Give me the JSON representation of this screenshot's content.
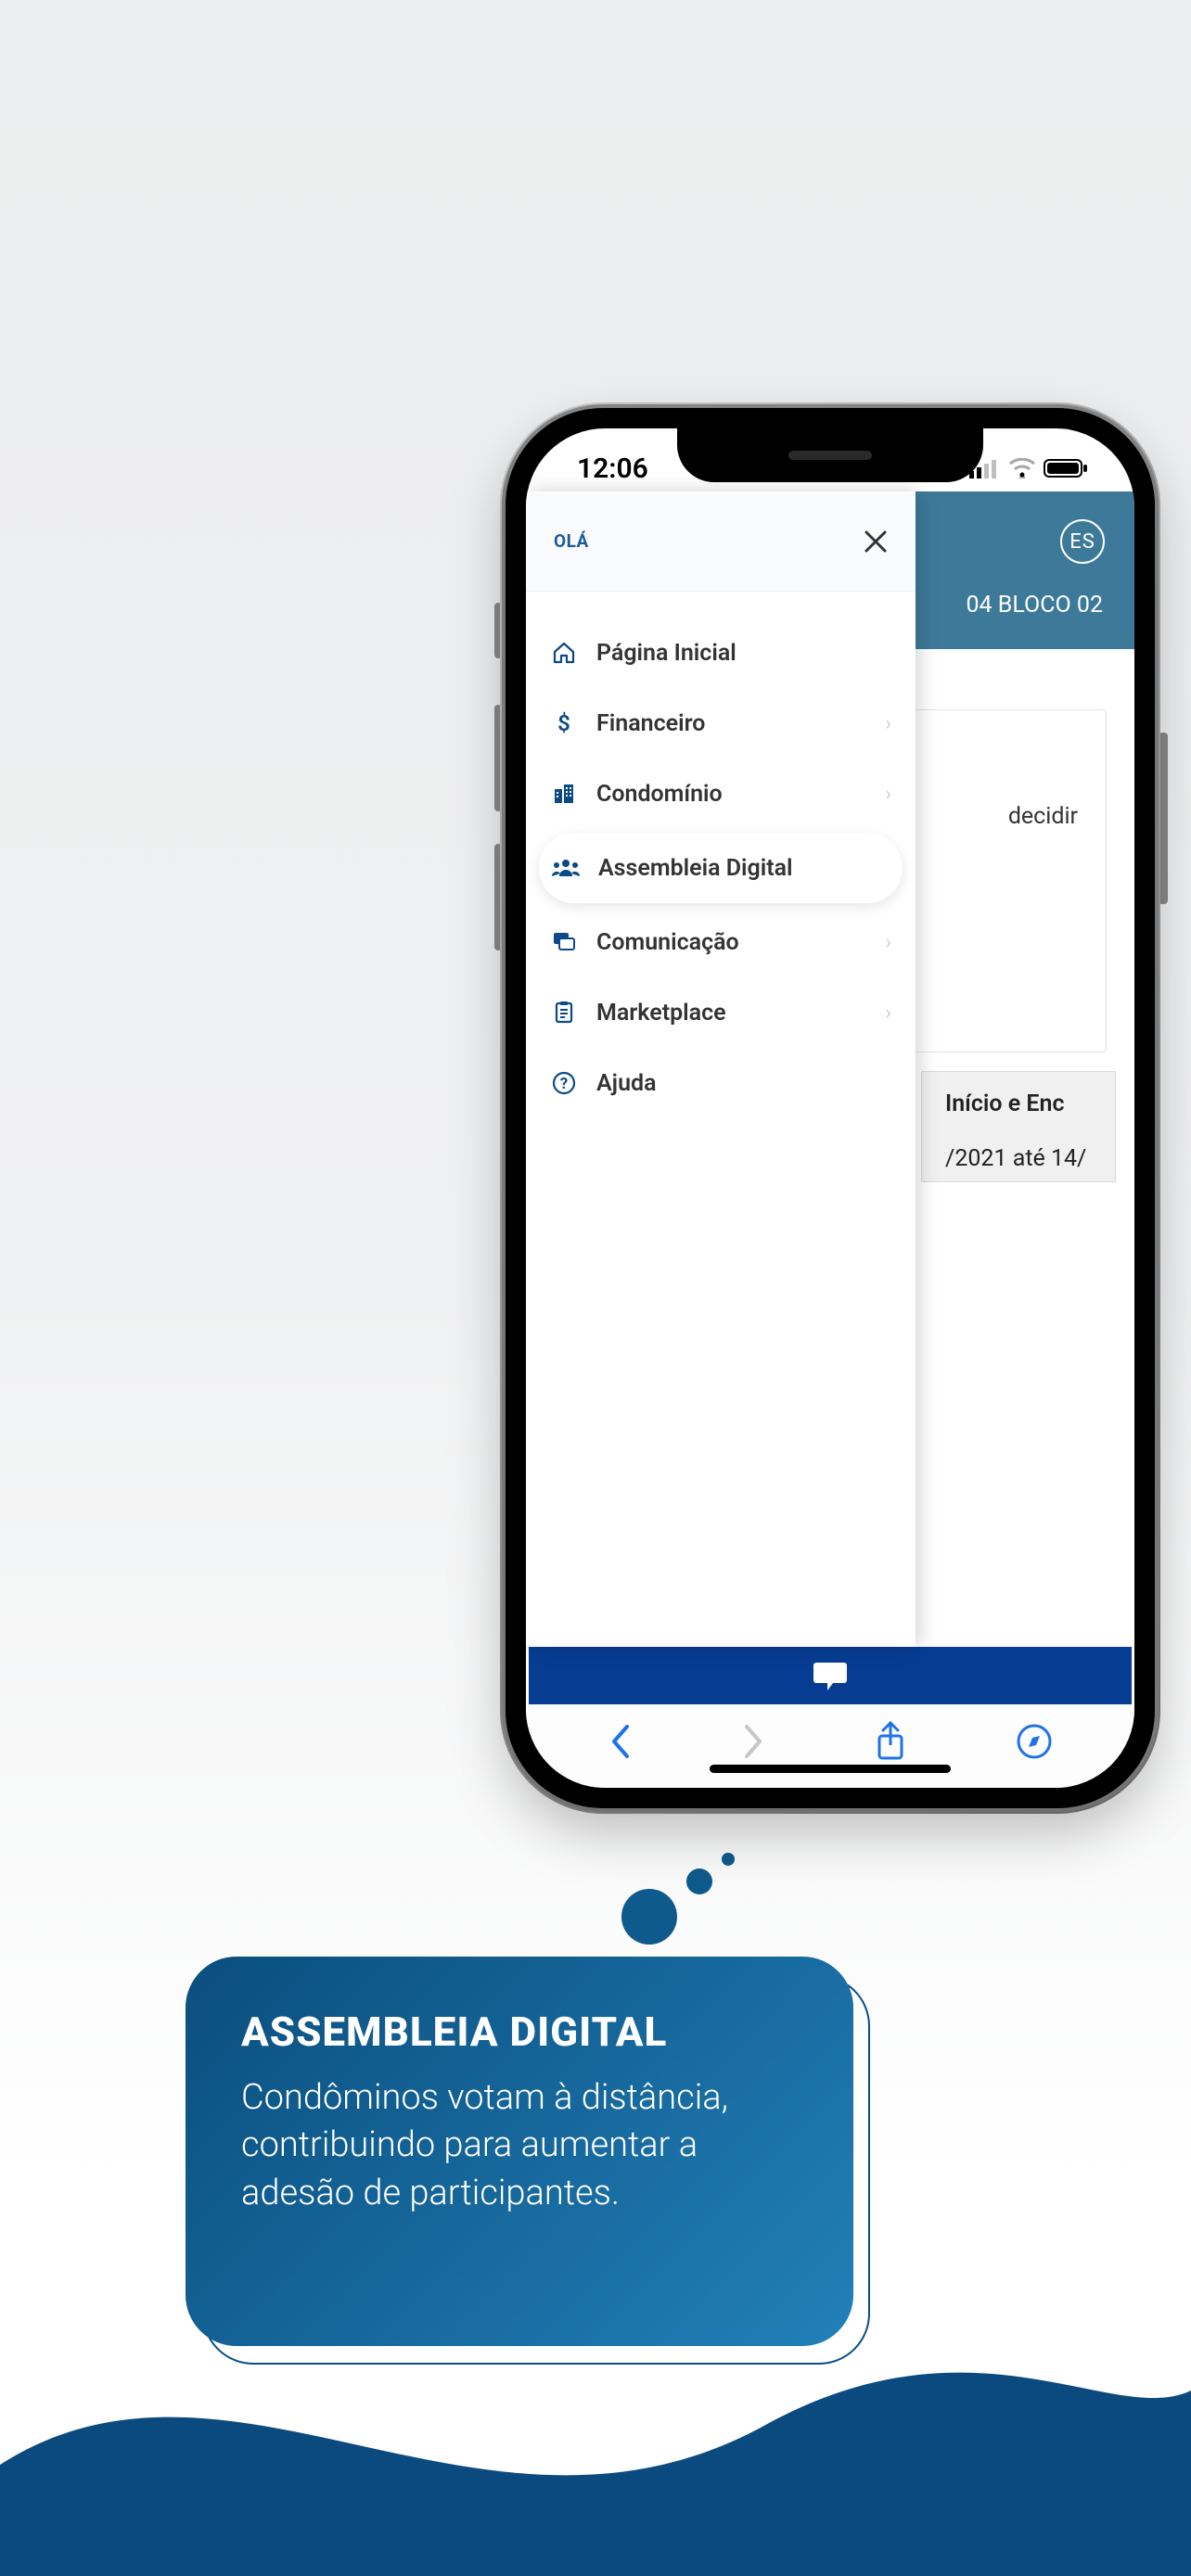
{
  "status": {
    "time": "12:06"
  },
  "app": {
    "es_badge": "ES",
    "header_sub": "04 BLOCO 02",
    "card_text": "decidir",
    "date_box_title": "Início e Enc",
    "date_box_dates": "/2021 até 14/"
  },
  "drawer": {
    "greeting": "OLÁ",
    "items": [
      {
        "label": "Página Inicial",
        "icon": "home",
        "chevron": false,
        "active": false
      },
      {
        "label": "Financeiro",
        "icon": "dollar",
        "chevron": true,
        "active": false
      },
      {
        "label": "Condomínio",
        "icon": "buildings",
        "chevron": true,
        "active": false
      },
      {
        "label": "Assembleia Digital",
        "icon": "people",
        "chevron": false,
        "active": true
      },
      {
        "label": "Comunicação",
        "icon": "chat",
        "chevron": true,
        "active": false
      },
      {
        "label": "Marketplace",
        "icon": "clipboard",
        "chevron": true,
        "active": false
      },
      {
        "label": "Ajuda",
        "icon": "help",
        "chevron": false,
        "active": false
      }
    ]
  },
  "caption": {
    "title": "ASSEMBLEIA DIGITAL",
    "text": "Condôminos votam à distância, contribuindo para aumentar a adesão de participantes."
  }
}
